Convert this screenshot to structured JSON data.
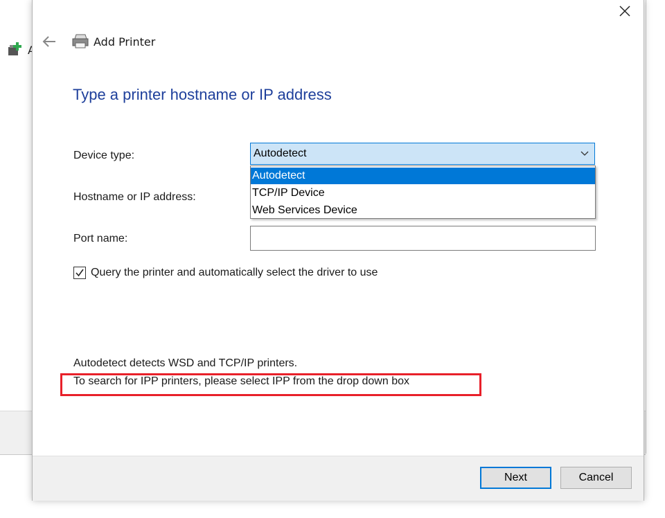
{
  "dialog": {
    "title": "Add Printer",
    "heading": "Type a printer hostname or IP address"
  },
  "form": {
    "device_type_label": "Device type:",
    "device_type_value": "Autodetect",
    "device_type_options": [
      "Autodetect",
      "TCP/IP Device",
      "Web Services Device"
    ],
    "hostname_label": "Hostname or IP address:",
    "port_label": "Port name:",
    "port_value": "",
    "query_checkbox_label": "Query the printer and automatically select the driver to use",
    "query_checked": true
  },
  "info": {
    "line1": "Autodetect detects WSD and TCP/IP printers.",
    "line2": "To search for IPP printers, please select IPP from the drop down box"
  },
  "footer": {
    "next_label": "Next",
    "cancel_label": "Cancel"
  },
  "background": {
    "partial_letter": "A"
  },
  "colors": {
    "heading": "#1e3f9b",
    "accent": "#0078d7",
    "highlight": "#e8202a"
  },
  "icons": {
    "close": "close-icon",
    "back": "back-arrow-icon",
    "printer": "printer-icon",
    "chevron": "chevron-down-icon",
    "check": "checkmark-icon"
  }
}
